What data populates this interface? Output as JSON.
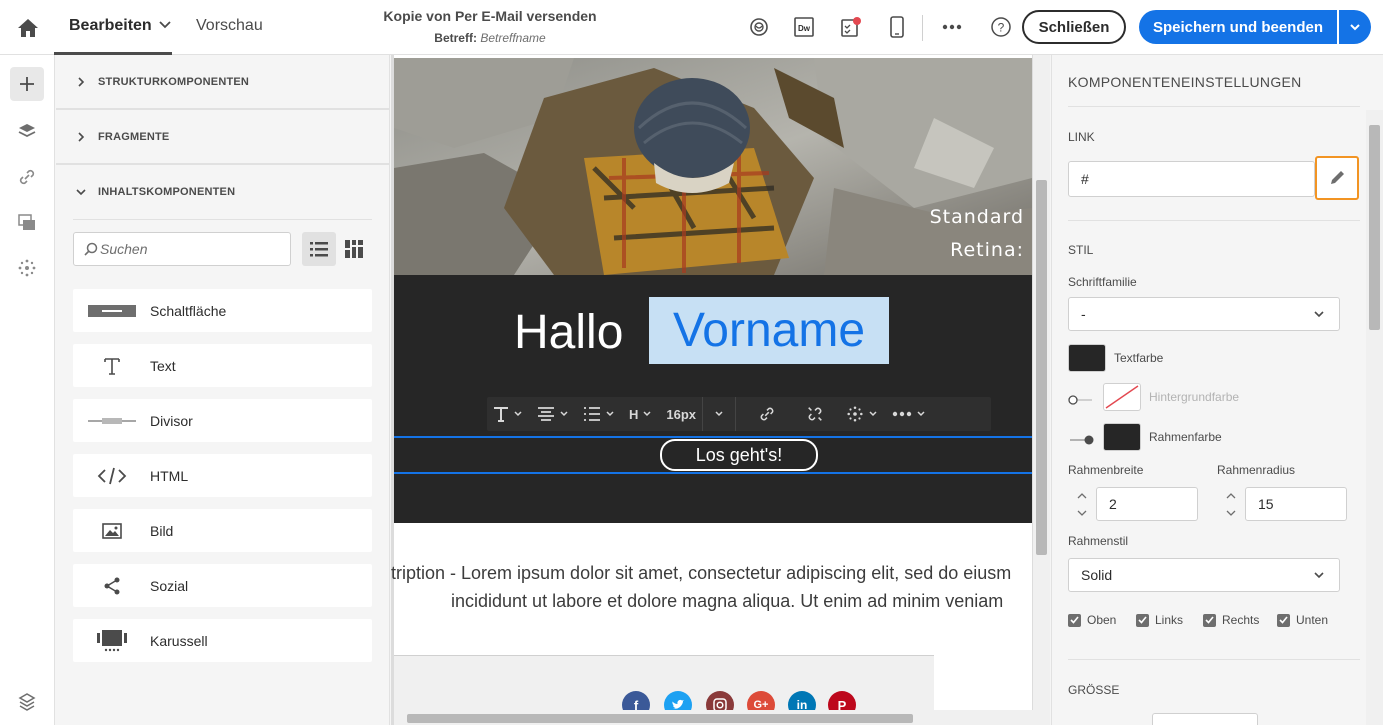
{
  "header": {
    "tab_edit": "Bearbeiten",
    "tab_preview": "Vorschau",
    "doc_title": "Kopie von Per E-Mail versenden",
    "subject_label": "Betreff:",
    "subject_value": "Betreffname",
    "dw_label": "Dw",
    "close_label": "Schließen",
    "save_label": "Speichern und beenden",
    "help_label": "?"
  },
  "panel": {
    "sections": [
      "STRUKTURKOMPONENTEN",
      "FRAGMENTE",
      "INHALTSKOMPONENTEN"
    ],
    "search_placeholder": "Suchen",
    "components": [
      {
        "label": "Schaltfläche",
        "icon": "button-icon"
      },
      {
        "label": "Text",
        "icon": "text-icon"
      },
      {
        "label": "Divisor",
        "icon": "divider-icon"
      },
      {
        "label": "HTML",
        "icon": "code-icon"
      },
      {
        "label": "Bild",
        "icon": "image-icon"
      },
      {
        "label": "Sozial",
        "icon": "share-icon"
      },
      {
        "label": "Karussell",
        "icon": "carousel-icon"
      }
    ]
  },
  "canvas": {
    "hero_line1": "Standard",
    "hero_line2": "Retina:",
    "hello": "Hallo",
    "firstname": "Vorname",
    "font_size": "16px",
    "heading_btn": "H",
    "cta": "Los geht's!",
    "desc_line1": "tription - Lorem ipsum dolor sit amet, consectetur adipiscing elit, sed do eiusm",
    "desc_line2": "incididunt ut labore et dolore magna aliqua. Ut enim ad minim veniam",
    "social": [
      "facebook",
      "twitter",
      "instagram",
      "google-plus",
      "linkedin",
      "pinterest"
    ]
  },
  "settings": {
    "title": "KOMPONENTENEINSTELLUNGEN",
    "link_label": "LINK",
    "link_value": "#",
    "style_label": "STIL",
    "font_family_label": "Schriftfamilie",
    "font_family_value": "-",
    "text_color_label": "Textfarbe",
    "bg_color_label": "Hintergrundfarbe",
    "border_color_label": "Rahmenfarbe",
    "border_width_label": "Rahmenbreite",
    "border_width_value": "2",
    "border_radius_label": "Rahmenradius",
    "border_radius_value": "15",
    "border_style_label": "Rahmenstil",
    "border_style_value": "Solid",
    "checks": [
      "Oben",
      "Links",
      "Rechts",
      "Unten"
    ],
    "size_label": "GRÖSSE"
  },
  "colors": {
    "accent": "#1473e6",
    "highlight": "#f29423",
    "dark_block": "#262626"
  }
}
